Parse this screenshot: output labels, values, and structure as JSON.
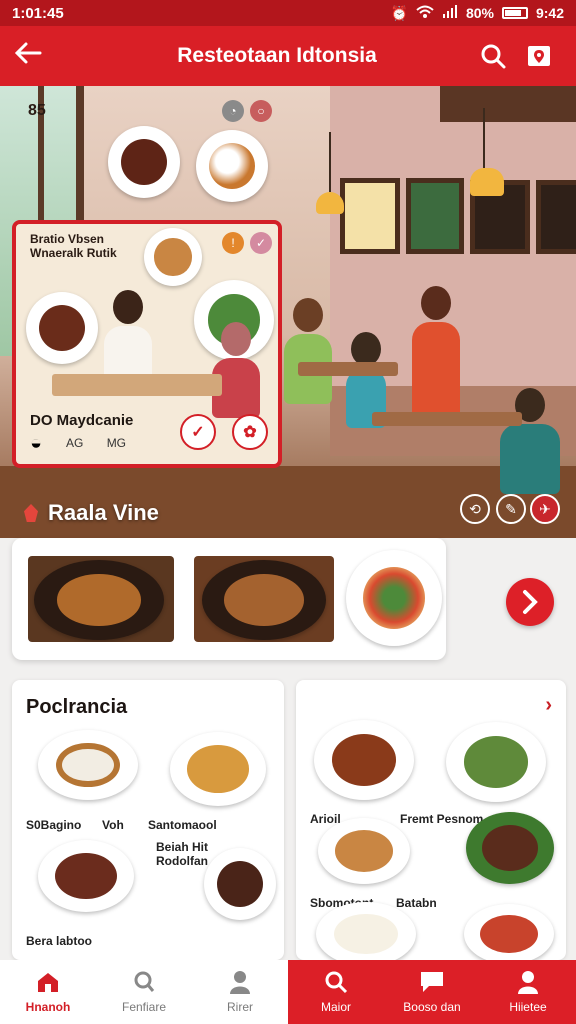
{
  "status_bar": {
    "time": "1:01:45",
    "battery": "80%",
    "clock": "9:42"
  },
  "app_bar": {
    "title": "Resteotaan Idtonsia"
  },
  "hero": {
    "top_badge": "85",
    "card": {
      "title_line1": "Bratio Vbsen",
      "title_line2": "Wnaeralk Rutik",
      "name": "DO Maydcanie",
      "meta1": "AG",
      "meta2": "MG"
    },
    "restaurant_name": "Raala Vine"
  },
  "panels": {
    "left": {
      "title": "Poclrancia",
      "labels": [
        "S0Bagino",
        "Voh",
        "Santomaool",
        "Beiah Hit",
        "Rodolfan",
        "Bera labtoo"
      ]
    },
    "right": {
      "labels": [
        "Arioil",
        "Fremt Pesnom",
        "Sbomotont",
        "Batabn"
      ]
    }
  },
  "bottom_nav": [
    {
      "label": "Hnanoh",
      "icon": "home-icon"
    },
    {
      "label": "Fenfiare",
      "icon": "search-person-icon"
    },
    {
      "label": "Rirer",
      "icon": "person-icon"
    },
    {
      "label": "Maior",
      "icon": "search-icon"
    },
    {
      "label": "Booso dan",
      "icon": "chat-icon"
    },
    {
      "label": "Hiietee",
      "icon": "profile-icon"
    }
  ],
  "colors": {
    "primary": "#d91f26",
    "status_bar": "#b3161c",
    "accent_red": "#dd2028"
  }
}
